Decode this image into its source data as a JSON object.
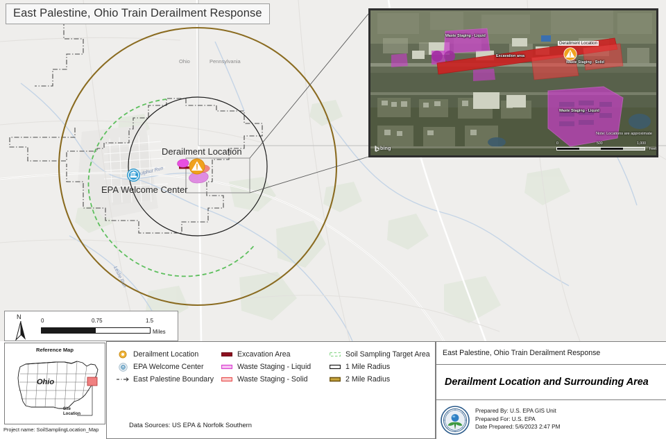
{
  "title": "East Palestine, Ohio Train Derailment Response",
  "map": {
    "labels": {
      "state_ohio": "Ohio",
      "state_pennsylvania": "Pennsylvania",
      "derailment_location": "Derailment Location",
      "epa_welcome_center": "EPA Welcome Center",
      "stream_sulphur_run": "Sulphur Run",
      "stream_leslie_run": "Leslie Run"
    },
    "scalebar": {
      "ticks": [
        "0",
        "0.75",
        "1.5"
      ],
      "unit": "Miles",
      "north_letter": "N"
    },
    "colors": {
      "radius_2mile": "#8a6b20",
      "radius_1mile": "#1a1a1a",
      "soil_sampling": "#5dbf5d",
      "excavation": "#8e1020",
      "waste_liquid": "#e84fe0",
      "waste_solid": "#f06a6a",
      "derail_marker": "#f0a21e",
      "basemap": "#efeeec"
    }
  },
  "inset": {
    "labels": {
      "waste_staging_liquid_upper": "Waste Staging - Liquid",
      "derailment_location": "Derailment Location",
      "excavation_area": "Excavation area",
      "waste_staging_solid": "Waste Staging - Solid",
      "waste_staging_liquid_lower": "Waste Staging - Liquid"
    },
    "note": "Note: Locations are approximate",
    "scalebar": {
      "ticks": [
        "0",
        "500",
        "1,000"
      ],
      "unit": "Feet"
    },
    "attribution": "bing"
  },
  "reference_map": {
    "title": "Reference Map",
    "state_label": "Ohio",
    "site_label_line1": "Site",
    "site_label_line2": "Location"
  },
  "project_name": "Project name: SoilSamplingLocation_Map",
  "legend": {
    "column1": [
      {
        "icon": "derailment-point-icon",
        "label": "Derailment Location"
      },
      {
        "icon": "epa-welcome-center-icon",
        "label": "EPA Welcome Center"
      },
      {
        "icon": "boundary-dashed-icon",
        "label": "East Palestine Boundary"
      }
    ],
    "column2": [
      {
        "icon": "excavation-swatch-icon",
        "label": "Excavation Area"
      },
      {
        "icon": "waste-liquid-swatch-icon",
        "label": "Waste Staging - Liquid"
      },
      {
        "icon": "waste-solid-swatch-icon",
        "label": "Waste Staging - Solid"
      }
    ],
    "column3": [
      {
        "icon": "soil-sampling-swatch-icon",
        "label": "Soil Sampling Target Area"
      },
      {
        "icon": "one-mile-swatch-icon",
        "label": "1 Mile Radius"
      },
      {
        "icon": "two-mile-swatch-icon",
        "label": "2 Mile Radius"
      }
    ],
    "data_sources": "Data Sources: US EPA & Norfolk Southern"
  },
  "info_panel": {
    "subtitle": "East Palestine, Ohio Train Derailment Response",
    "main_title": "Derailment Location and Surrounding Area",
    "prepared_by": "Prepared By: U.S. EPA GIS Unit",
    "prepared_for": "Prepared For: U.S. EPA",
    "date_prepared": "Date Prepared: 5/6/2023 2:47 PM",
    "seal": "epa-seal-icon"
  }
}
